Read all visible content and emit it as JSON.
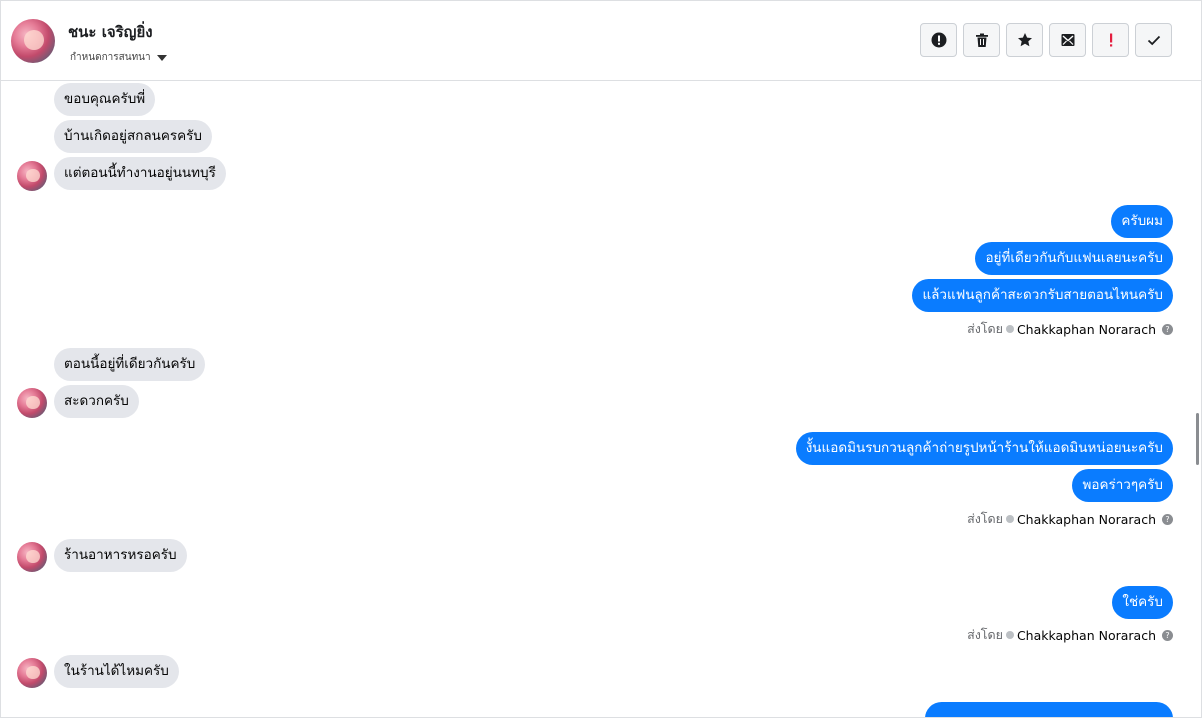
{
  "contact": {
    "name": "ชนะ เจริญยิ่ง",
    "assign_label": "กำหนดการสนทนา"
  },
  "actions": [
    {
      "name": "report-icon",
      "label": "!"
    },
    {
      "name": "trash-icon"
    },
    {
      "name": "star-icon"
    },
    {
      "name": "mark-unread-icon"
    },
    {
      "name": "important-icon",
      "label": "!"
    },
    {
      "name": "check-icon"
    }
  ],
  "colors": {
    "outgoing": "#0a7cff",
    "incoming": "#e4e6eb",
    "important": "#e41e3f"
  },
  "messages": {
    "m1": "ขอบคุณครับพี่",
    "m2": "บ้านเกิดอยู่สกลนครครับ",
    "m3": "แต่ตอนนี้ทำงานอยู่นนทบุรี",
    "m4": "ครับผม",
    "m5": "อยู่ที่เดียวกันกับแฟนเลยนะครับ",
    "m6": "แล้วแฟนลูกค้าสะดวกรับสายตอนไหนครับ",
    "m7": "ตอนนี้อยู่ที่เดียวกันครับ",
    "m8": "สะดวกครับ",
    "m9": "งั้นแอดมินรบกวนลูกค้าถ่ายรูปหน้าร้านให้แอดมินหน่อยนะครับ",
    "m10": "พอคร่าวๆครับ",
    "m11": "ร้านอาหารหรอครับ",
    "m12": "ใช่ครับ",
    "m13": "ในร้านได้ไหมครับ"
  },
  "sent_by": {
    "prefix": "ส่งโดย",
    "sender": "Chakkaphan Norarach",
    "help": "?"
  }
}
